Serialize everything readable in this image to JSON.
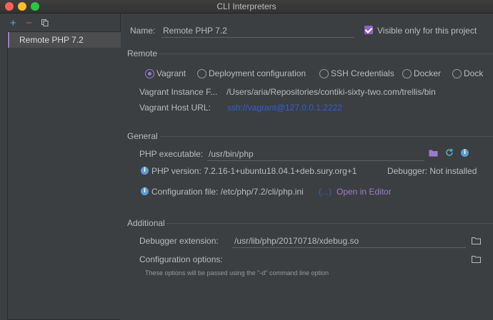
{
  "window": {
    "title": "CLI Interpreters"
  },
  "toolbar": {
    "add_icon": "+",
    "remove_icon": "−"
  },
  "interpreters": [
    {
      "label": "Remote PHP 7.2"
    }
  ],
  "name_field": {
    "label": "Name:",
    "value": "Remote PHP 7.2"
  },
  "visible_only": {
    "label": "Visible only for this project",
    "checked": true
  },
  "remote": {
    "section_label": "Remote",
    "options": [
      "Vagrant",
      "Deployment configuration",
      "SSH Credentials",
      "Docker",
      "Dock"
    ],
    "selected": "Vagrant",
    "instance_label": "Vagrant Instance F...",
    "instance_value": "/Users/aria/Repositories/contiki-sixty-two.com/trellis/bin",
    "host_label": "Vagrant Host URL:",
    "host_value": "ssh://vagrant@127.0.0.1:2222"
  },
  "general": {
    "section_label": "General",
    "php_exec_label": "PHP executable:",
    "php_exec_value": "/usr/bin/php",
    "php_version": "PHP version: 7.2.16-1+ubuntu18.04.1+deb.sury.org+1",
    "debugger": "Debugger: Not installed",
    "config_file": "Configuration file: /etc/php/7.2/cli/php.ini",
    "config_ellipsis": "(...)",
    "open_in_editor": "Open in Editor"
  },
  "additional": {
    "section_label": "Additional",
    "debugger_ext_label": "Debugger extension:",
    "debugger_ext_value": "/usr/lib/php/20170718/xdebug.so",
    "config_options_label": "Configuration options:",
    "hint": "These options will be passed using the \"-d\" command line option"
  },
  "colors": {
    "accent": "#9d7ccf",
    "link": "#2f5ed8",
    "background": "#3c3f41"
  }
}
